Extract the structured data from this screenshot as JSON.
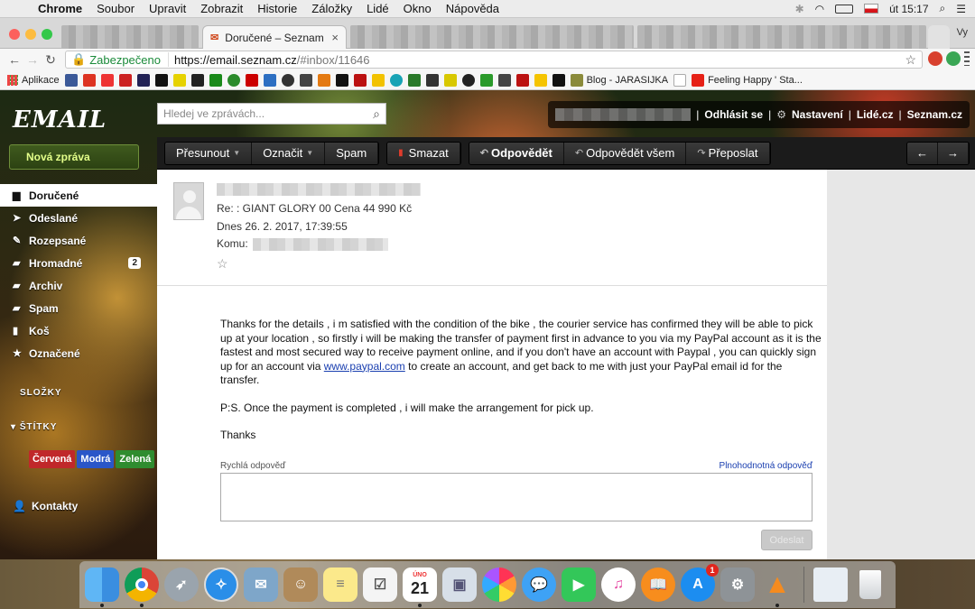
{
  "menubar": {
    "app": "Chrome",
    "items": [
      "Soubor",
      "Upravit",
      "Zobrazit",
      "Historie",
      "Záložky",
      "Lidé",
      "Okno",
      "Nápověda"
    ],
    "clock": "út 15:17"
  },
  "browser": {
    "active_tab_title": "Doručené – Seznam Em",
    "profile_label": "Vy",
    "secure_label": "Zabezpečeno",
    "url_host": "https://email.seznam.cz",
    "url_path": "/#inbox/11646",
    "bookmarks": {
      "apps_label": "Aplikace",
      "blog_label": "Blog - JARASIJKA",
      "feeling_label": "Feeling Happy ' Sta..."
    }
  },
  "email_app": {
    "logo": "EMAIL",
    "search_placeholder": "Hledej ve zprávách...",
    "userbar": {
      "logout": "Odhlásit se",
      "settings": "Nastavení",
      "lide": "Lidé.cz",
      "seznam": "Seznam.cz"
    },
    "new_message": "Nová zpráva",
    "folders": [
      {
        "label": "Doručené",
        "icon": "inbox-icon",
        "glyph": "▆"
      },
      {
        "label": "Odeslané",
        "icon": "send-icon",
        "glyph": "➤"
      },
      {
        "label": "Rozepsané",
        "icon": "draft-icon",
        "glyph": "✎"
      },
      {
        "label": "Hromadné",
        "icon": "folder-icon",
        "glyph": "▰",
        "count": "2"
      },
      {
        "label": "Archiv",
        "icon": "archive-icon",
        "glyph": "▰"
      },
      {
        "label": "Spam",
        "icon": "spam-icon",
        "glyph": "▰"
      },
      {
        "label": "Koš",
        "icon": "trash-icon",
        "glyph": "▮"
      },
      {
        "label": "Označené",
        "icon": "star-icon",
        "glyph": "★"
      }
    ],
    "folders_section": "SLOŽKY",
    "labels_section": "ŠTÍTKY",
    "labels": [
      {
        "label": "Červená",
        "color": "#c0282a"
      },
      {
        "label": "Modrá",
        "color": "#2a56c8"
      },
      {
        "label": "Zelená",
        "color": "#2f8c2f"
      }
    ],
    "contacts": "Kontakty",
    "actions": {
      "move": "Přesunout",
      "mark": "Označit",
      "spam": "Spam",
      "delete": "Smazat",
      "reply": "Odpovědět",
      "reply_all": "Odpovědět všem",
      "forward": "Přeposlat",
      "prev_arrow": "←",
      "next_arrow": "→"
    },
    "message": {
      "subject": "Re: : GIANT GLORY 00 Cena 44 990 Kč",
      "date": "Dnes 26. 2. 2017, 17:39:55",
      "to_label": "Komu:",
      "body_p1_before": "Thanks for the details , i m satisfied with the condition of the bike , the courier service has confirmed they will be able to pick up at your location , so firstly i will be making the transfer of payment first in advance to you via my PayPal account  as it is the fastest and most secured way to receive payment online, and if you don't have an account with Paypal , you can quickly sign up for an account via ",
      "body_link": "www.paypal.com",
      "body_p1_after": " to create an account, and get back to me with just your PayPal email id for the transfer.",
      "body_p2": "P:S. Once the payment is completed , i will make the arrangement for pick up.",
      "body_p3": "Thanks"
    },
    "quick_reply_label": "Rychlá odpověď",
    "full_reply_link": "Plnohodnotná odpověď",
    "send_button": "Odeslat"
  },
  "dock": {
    "calendar_month": "ÚNO",
    "calendar_day": "21",
    "appstore_badge": "1"
  }
}
